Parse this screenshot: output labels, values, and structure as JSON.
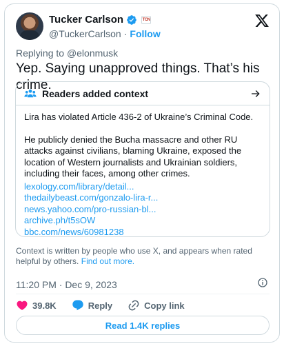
{
  "author": {
    "name": "Tucker Carlson",
    "handle": "@TuckerCarlson",
    "separator": "·",
    "follow_label": "Follow",
    "affiliation_badge": "TCN"
  },
  "reply_context": {
    "prefix": "Replying to ",
    "mention": "@elonmusk"
  },
  "tweet": {
    "text": "Yep. Saying unapproved things. That’s his crime."
  },
  "note": {
    "title": "Readers added context",
    "paragraph1": "Lira has violated Article 436-2 of Ukraine’s Criminal Code.",
    "paragraph2": "He publicly denied the Bucha massacre and other RU attacks against civilians, blaming Ukraine, exposed the location of Western journalists and Ukrainian soldiers, including their faces, among other crimes.",
    "links": [
      "lexology.com/library/detail...",
      "thedailybeast.com/gonzalo-lira-r...",
      "news.yahoo.com/pro-russian-bl...",
      "archive.ph/t5sOW",
      "bbc.com/news/60981238"
    ]
  },
  "context_notice": {
    "text": "Context is written by people who use X, and appears when rated helpful by others. ",
    "learn_more": "Find out more."
  },
  "meta": {
    "timestamp": "11:20 PM · Dec 9, 2023"
  },
  "actions": {
    "like_count": "39.8K",
    "reply_label": "Reply",
    "copy_link_label": "Copy link"
  },
  "replies_button": "Read 1.4K replies",
  "colors": {
    "accent": "#1d9bf0",
    "like": "#f91880",
    "verified": "#1d9bf0",
    "text_secondary": "#536471"
  },
  "icons": [
    "verified-badge-icon",
    "x-logo-icon",
    "people-icon",
    "arrow-right-icon",
    "info-icon",
    "heart-icon",
    "reply-bubble-icon",
    "link-icon"
  ]
}
